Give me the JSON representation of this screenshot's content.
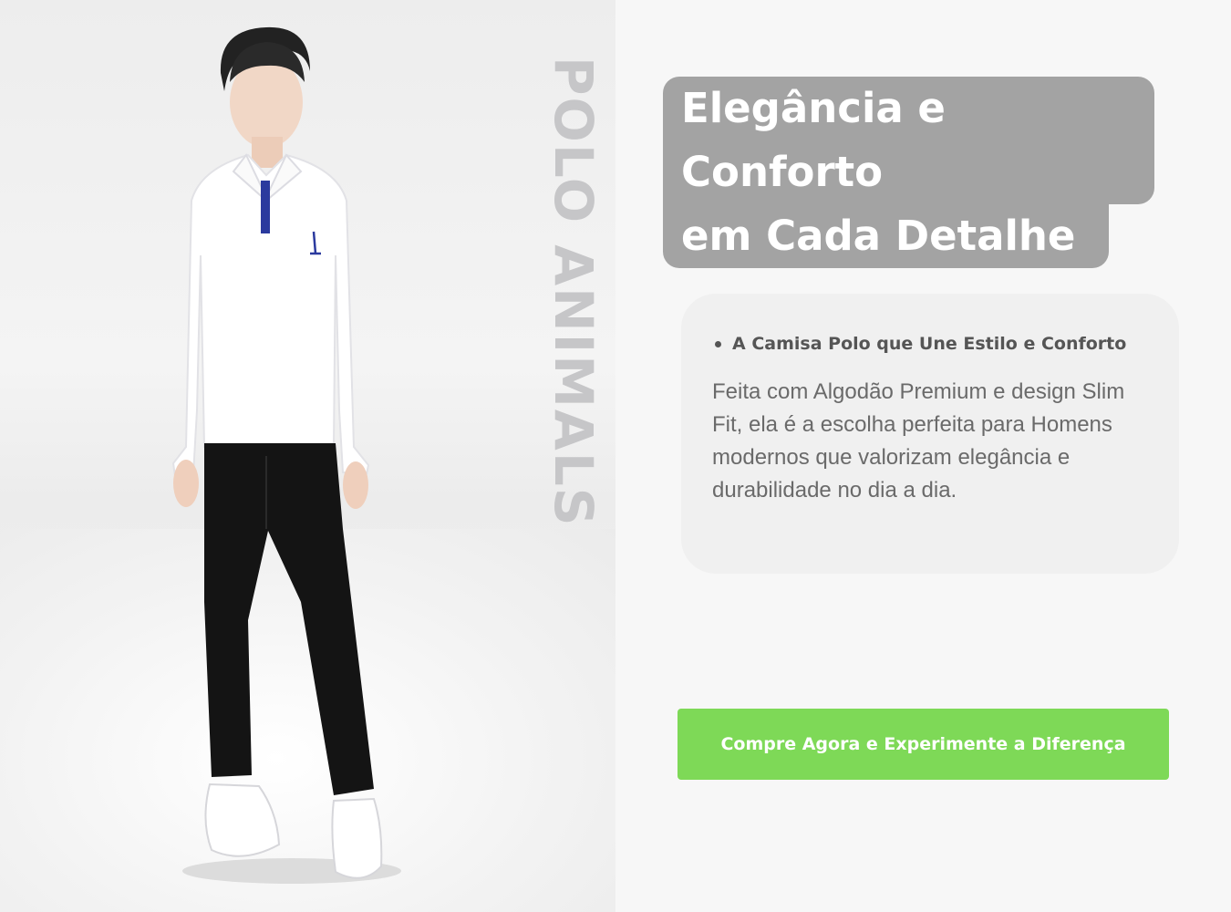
{
  "brand": {
    "vertical_text": "POLO ANIMALS"
  },
  "hero": {
    "headline_line1": "Elegância e Conforto",
    "headline_line2": "em Cada Detalhe"
  },
  "info_card": {
    "bullet": "A Camisa Polo que Une Estilo e Conforto",
    "description": "Feita com Algodão Premium e design Slim Fit, ela é a escolha perfeita para Homens modernos que valorizam elegância e durabilidade no dia a dia."
  },
  "cta": {
    "label": "Compre Agora e Experimente a Diferença"
  },
  "colors": {
    "cta_green": "#7ed957",
    "headline_bg": "#a3a3a3",
    "brand_text": "#c6c6c8",
    "logo_blue": "#2b3a9e"
  },
  "image": {
    "subject": "model-in-white-polo-and-black-trousers"
  }
}
